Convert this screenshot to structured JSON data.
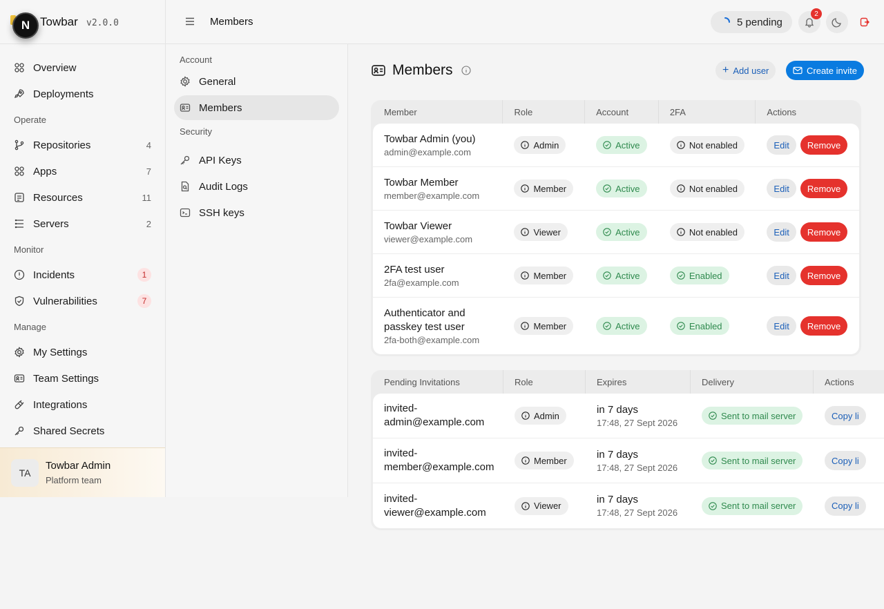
{
  "brand": {
    "logo_letter": "N",
    "name": "Towbar",
    "version": "v2.0.0"
  },
  "sidebar": {
    "items_top": [
      {
        "label": "Overview",
        "icon": "grid-icon"
      },
      {
        "label": "Deployments",
        "icon": "rocket-icon"
      }
    ],
    "operate_label": "Operate",
    "operate": [
      {
        "label": "Repositories",
        "count": "4",
        "icon": "git-branch-icon"
      },
      {
        "label": "Apps",
        "count": "7",
        "icon": "grid-icon"
      },
      {
        "label": "Resources",
        "count": "11",
        "icon": "database-icon"
      },
      {
        "label": "Servers",
        "count": "2",
        "icon": "server-icon"
      }
    ],
    "monitor_label": "Monitor",
    "monitor": [
      {
        "label": "Incidents",
        "count": "1",
        "icon": "alert-circle-icon"
      },
      {
        "label": "Vulnerabilities",
        "count": "7",
        "icon": "shield-icon"
      }
    ],
    "manage_label": "Manage",
    "manage": [
      {
        "label": "My Settings",
        "icon": "gear-icon"
      },
      {
        "label": "Team Settings",
        "icon": "id-card-icon"
      },
      {
        "label": "Integrations",
        "icon": "plug-icon"
      },
      {
        "label": "Shared Secrets",
        "icon": "key-icon"
      }
    ],
    "user": {
      "initials": "TA",
      "name": "Towbar Admin",
      "team": "Platform team"
    }
  },
  "topbar": {
    "title": "Members",
    "pending": "5 pending",
    "notifications": "2"
  },
  "subnav": {
    "account_label": "Account",
    "account": [
      {
        "label": "General",
        "icon": "gear-icon"
      },
      {
        "label": "Members",
        "icon": "id-card-icon",
        "active": true
      }
    ],
    "security_label": "Security",
    "security": [
      {
        "label": "API Keys",
        "icon": "key-icon"
      },
      {
        "label": "Audit Logs",
        "icon": "file-search-icon"
      },
      {
        "label": "SSH keys",
        "icon": "terminal-icon"
      }
    ]
  },
  "main": {
    "title": "Members",
    "add_user": "Add user",
    "create_invite": "Create invite",
    "members_table": {
      "headers": [
        "Member",
        "Role",
        "Account",
        "2FA",
        "Actions"
      ],
      "rows": [
        {
          "name": "Towbar Admin (you)",
          "email": "admin@example.com",
          "role": "Admin",
          "account": "Active",
          "twofa": "Not enabled",
          "twofa_ok": false
        },
        {
          "name": "Towbar Member",
          "email": "member@example.com",
          "role": "Member",
          "account": "Active",
          "twofa": "Not enabled",
          "twofa_ok": false
        },
        {
          "name": "Towbar Viewer",
          "email": "viewer@example.com",
          "role": "Viewer",
          "account": "Active",
          "twofa": "Not enabled",
          "twofa_ok": false
        },
        {
          "name": "2FA test user",
          "email": "2fa@example.com",
          "role": "Member",
          "account": "Active",
          "twofa": "Enabled",
          "twofa_ok": true
        },
        {
          "name": "Authenticator and passkey test user",
          "email": "2fa-both@example.com",
          "role": "Member",
          "account": "Active",
          "twofa": "Enabled",
          "twofa_ok": true
        }
      ],
      "edit_label": "Edit",
      "remove_label": "Remove"
    },
    "invites_table": {
      "headers": [
        "Pending Invitations",
        "Role",
        "Expires",
        "Delivery",
        "Actions"
      ],
      "rows": [
        {
          "email_line1": "invited-",
          "email_line2": "admin@example.com",
          "role": "Admin",
          "expires": "in 7 days",
          "expires_at": "17:48, 27 Sept 2026",
          "delivery": "Sent to mail server"
        },
        {
          "email_line1": "invited-",
          "email_line2": "member@example.com",
          "role": "Member",
          "expires": "in 7 days",
          "expires_at": "17:48, 27 Sept 2026",
          "delivery": "Sent to mail server"
        },
        {
          "email_line1": "invited-",
          "email_line2": "viewer@example.com",
          "role": "Viewer",
          "expires": "in 7 days",
          "expires_at": "17:48, 27 Sept 2026",
          "delivery": "Sent to mail server"
        }
      ],
      "copy_label": "Copy li"
    }
  }
}
